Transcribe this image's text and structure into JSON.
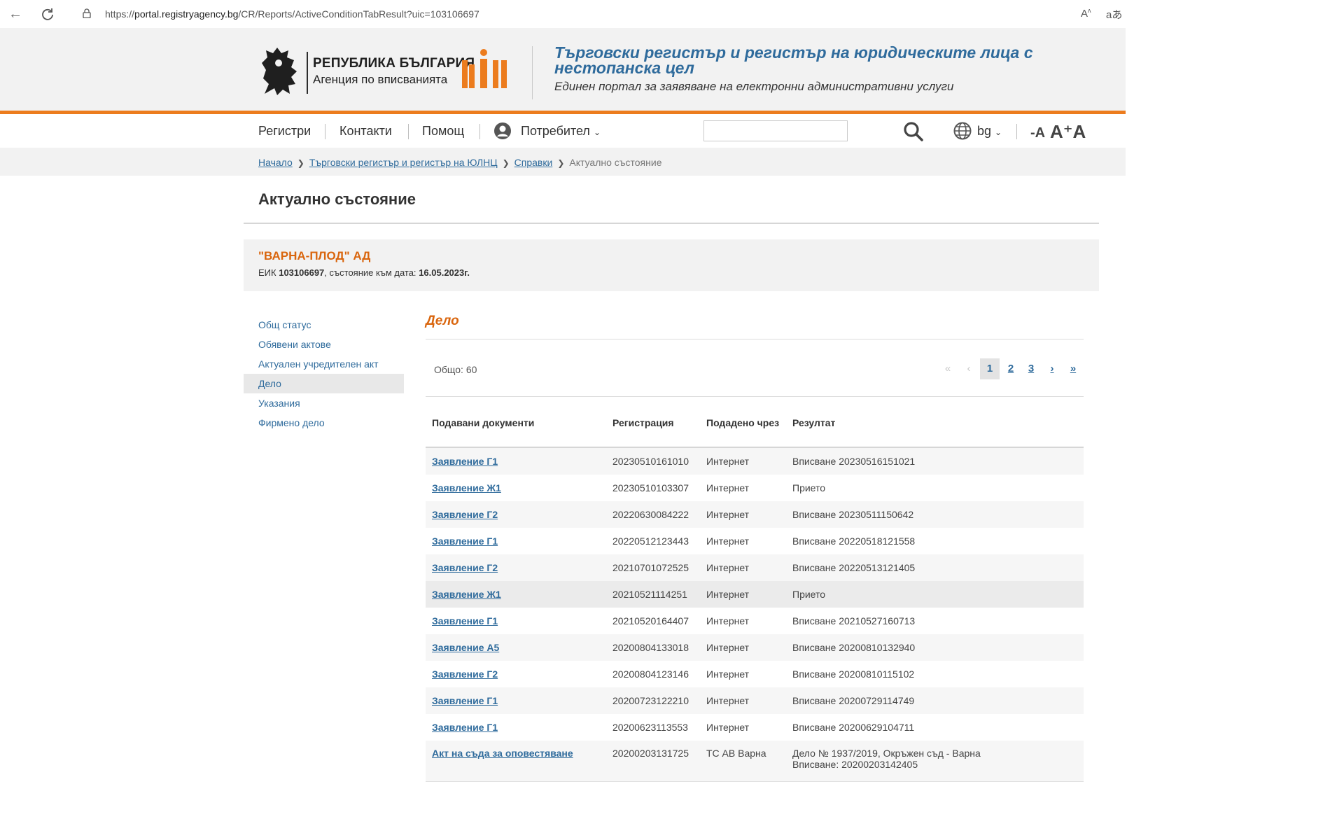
{
  "browser": {
    "url_prefix": "https://",
    "url_host": "portal.registryagency.bg",
    "url_path": "/CR/Reports/ActiveConditionTabResult?uic=103106697",
    "read_aloud_icon": "read-aloud-icon",
    "translate_icon": "translate-icon"
  },
  "header": {
    "agency_title": "РЕПУБЛИКА БЪЛГАРИЯ",
    "agency_subtitle": "Агенция по вписванията",
    "registry_title": "Търговски регистър и регистър на юридическите лица с нестопанска цел",
    "registry_subtitle": "Единен портал за заявяване на електронни административни услуги",
    "accent_color": "#ec7c1e",
    "title_color": "#2f6b9c"
  },
  "nav": {
    "registries": "Регистри",
    "contacts": "Контакти",
    "help": "Помощ",
    "user": "Потребител",
    "lang": "bg",
    "font_smaller": "-A",
    "font_larger": "A⁺A"
  },
  "breadcrumb": {
    "home": "Начало",
    "registry": "Търговски регистър и регистър на ЮЛНЦ",
    "reports": "Справки",
    "current": "Актуално състояние"
  },
  "page": {
    "title": "Актуално състояние"
  },
  "company": {
    "name": "\"ВАРНА-ПЛОД\" АД",
    "eik_label": "ЕИК",
    "eik": "103106697",
    "state_label": ", състояние към дата:",
    "date": "16.05.2023г."
  },
  "sidemenu": {
    "items": [
      {
        "label": "Общ статус"
      },
      {
        "label": "Обявени актове"
      },
      {
        "label": "Актуален учредителен акт"
      },
      {
        "label": "Дело"
      },
      {
        "label": "Указания"
      },
      {
        "label": "Фирмено дело"
      }
    ],
    "active_index": 3
  },
  "content": {
    "section_title": "Дело",
    "total": "Общо: 60",
    "pager": {
      "first": "«",
      "prev": "‹",
      "pages": [
        "1",
        "2",
        "3"
      ],
      "current": "1",
      "next": "›",
      "last": "»"
    },
    "columns": [
      "Подавани документи",
      "Регистрация",
      "Подадено чрез",
      "Резултат"
    ],
    "rows": [
      {
        "doc": "Заявление Г1",
        "reg": "20230510161010",
        "via": "Интернет",
        "result": "Вписване 20230516151021"
      },
      {
        "doc": "Заявление Ж1",
        "reg": "20230510103307",
        "via": "Интернет",
        "result": "Прието"
      },
      {
        "doc": "Заявление Г2",
        "reg": "20220630084222",
        "via": "Интернет",
        "result": "Вписване 20230511150642"
      },
      {
        "doc": "Заявление Г1",
        "reg": "20220512123443",
        "via": "Интернет",
        "result": "Вписване 20220518121558"
      },
      {
        "doc": "Заявление Г2",
        "reg": "20210701072525",
        "via": "Интернет",
        "result": "Вписване 20220513121405"
      },
      {
        "doc": "Заявление Ж1",
        "reg": "20210521114251",
        "via": "Интернет",
        "result": "Прието"
      },
      {
        "doc": "Заявление Г1",
        "reg": "20210520164407",
        "via": "Интернет",
        "result": "Вписване 20210527160713"
      },
      {
        "doc": "Заявление А5",
        "reg": "20200804133018",
        "via": "Интернет",
        "result": "Вписване 20200810132940"
      },
      {
        "doc": "Заявление Г2",
        "reg": "20200804123146",
        "via": "Интернет",
        "result": "Вписване 20200810115102"
      },
      {
        "doc": "Заявление Г1",
        "reg": "20200723122210",
        "via": "Интернет",
        "result": "Вписване 20200729114749"
      },
      {
        "doc": "Заявление Г1",
        "reg": "20200623113553",
        "via": "Интернет",
        "result": "Вписване 20200629104711"
      },
      {
        "doc": "Акт на съда за оповестяване",
        "reg": "20200203131725",
        "via": "ТС АВ Варна",
        "result": "Дело № 1937/2019, Окръжен съд - Варна",
        "result_line2": "Вписване: 20200203142405"
      }
    ]
  }
}
